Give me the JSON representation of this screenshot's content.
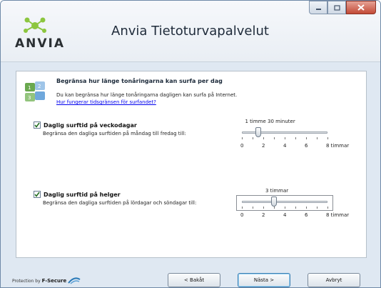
{
  "app": {
    "logo_text": "ANVIA",
    "title": "Anvia Tietoturvapalvelut"
  },
  "window_controls": {
    "minimize_icon": "minimize-icon",
    "maximize_icon": "maximize-icon",
    "close_icon": "close-icon"
  },
  "content": {
    "heading": "Begränsa hur länge tonåringarna kan surfa per dag",
    "description": "Du kan begränsa hur länge tonåringarna dagligen kan surfa på Internet.",
    "help_link": "Hur fungerar tidsgränsen för surfandet?"
  },
  "weekdays": {
    "checked": true,
    "label": "Daglig surftid på veckodagar",
    "description": "Begränsa den dagliga surftiden på måndag till fredag till:",
    "value_text": "1 timme 30 minuter",
    "value_hours": 1.5,
    "ticks": [
      "0",
      "2",
      "4",
      "6",
      "8 timmar"
    ]
  },
  "weekends": {
    "checked": true,
    "label": "Daglig surftid på helger",
    "description": "Begränsa den dagliga surftiden på lördagar och söndagar till:",
    "value_text": "3 timmar",
    "value_hours": 3,
    "ticks": [
      "0",
      "2",
      "4",
      "6",
      "8 timmar"
    ]
  },
  "footer": {
    "protection_prefix": "Protection by",
    "protection_brand": "F-Secure",
    "back_label": "< Bakåt",
    "next_label": "Nästa >",
    "cancel_label": "Avbryt"
  }
}
